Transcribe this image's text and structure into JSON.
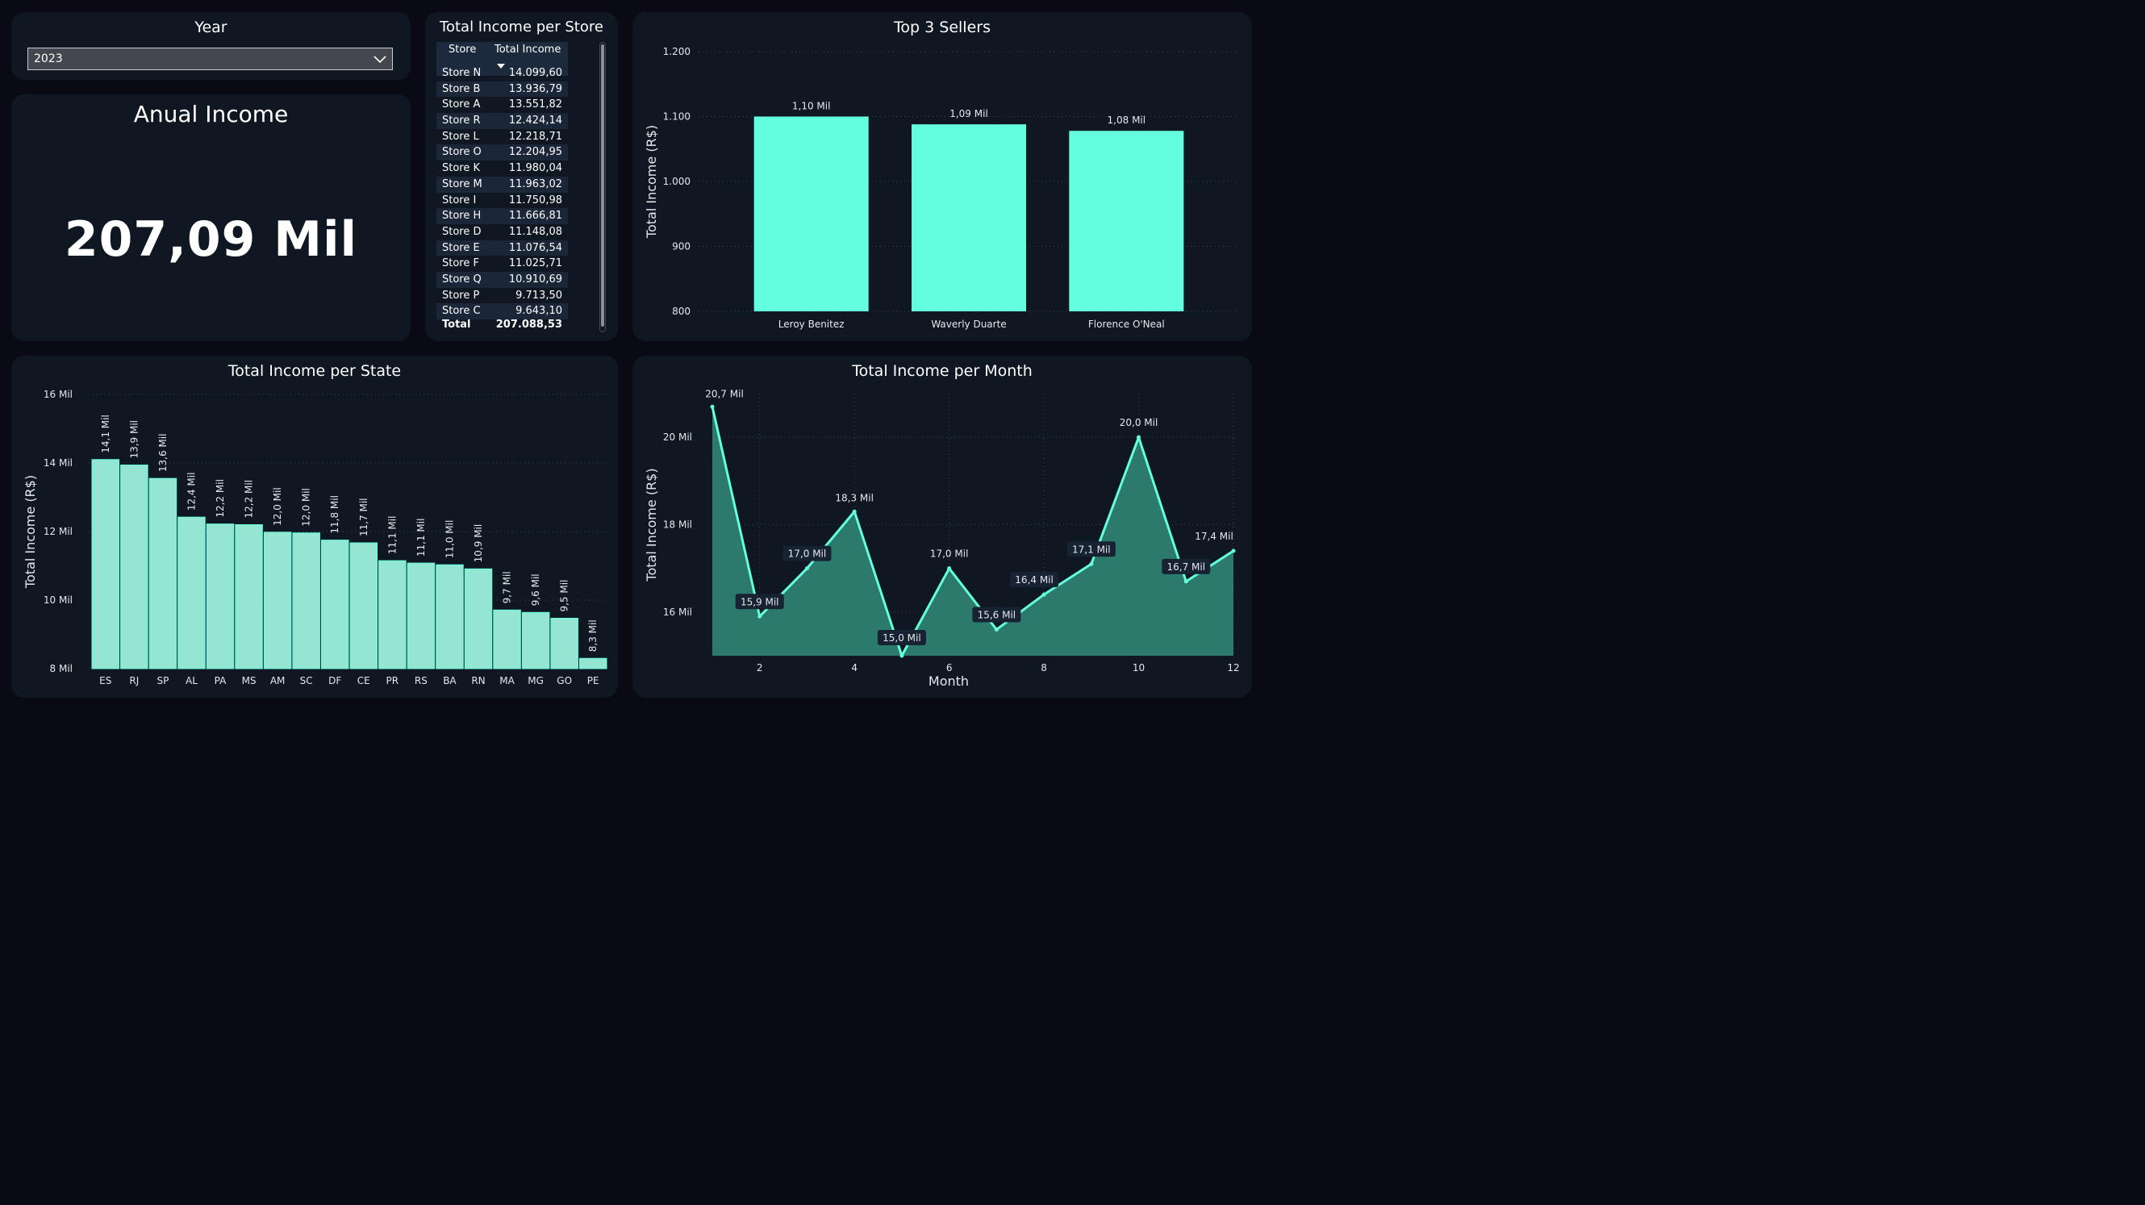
{
  "colors": {
    "background": "#090a14",
    "card": "#0e1722",
    "accent": "#64ffdf",
    "bar_state": "#94e6d3",
    "area_fill": "#2b7a6c",
    "line": "#64ffdf"
  },
  "year_filter": {
    "title": "Year",
    "selected": "2023",
    "icon": "chevron-down-icon"
  },
  "kpi": {
    "title": "Anual Income",
    "value": "207,09 Mil"
  },
  "store_table": {
    "title": "Total Income per Store",
    "headers": [
      "Store",
      "Total Income"
    ],
    "sort_indicator": "sort-descending-icon",
    "rows": [
      [
        "Store N",
        "14.099,60"
      ],
      [
        "Store B",
        "13.936,79"
      ],
      [
        "Store A",
        "13.551,82"
      ],
      [
        "Store R",
        "12.424,14"
      ],
      [
        "Store L",
        "12.218,71"
      ],
      [
        "Store O",
        "12.204,95"
      ],
      [
        "Store K",
        "11.980,04"
      ],
      [
        "Store M",
        "11.963,02"
      ],
      [
        "Store I",
        "11.750,98"
      ],
      [
        "Store H",
        "11.666,81"
      ],
      [
        "Store D",
        "11.148,08"
      ],
      [
        "Store E",
        "11.076,54"
      ],
      [
        "Store F",
        "11.025,71"
      ],
      [
        "Store Q",
        "10.910,69"
      ],
      [
        "Store P",
        "9.713,50"
      ],
      [
        "Store C",
        "9.643,10"
      ]
    ],
    "total": [
      "Total",
      "207.088,53"
    ]
  },
  "chart_data": [
    {
      "type": "bar",
      "title": "Top 3 Sellers",
      "xlabel": "",
      "ylabel": "Total Income (R$)",
      "categories": [
        "Leroy Benitez",
        "Waverly Duarte",
        "Florence O'Neal"
      ],
      "values": [
        1100,
        1088,
        1078
      ],
      "data_labels": [
        "1,10 Mil",
        "1,09 Mil",
        "1,08 Mil"
      ],
      "ylim": [
        800,
        1200
      ],
      "yticks": [
        800,
        900,
        1000,
        1100,
        1200
      ],
      "ytick_labels": [
        "800",
        "900",
        "1.000",
        "1.100",
        "1.200"
      ],
      "grid": true
    },
    {
      "type": "bar",
      "title": "Total Income per State",
      "xlabel": "",
      "ylabel": "Total Income (R$)",
      "categories": [
        "ES",
        "RJ",
        "SP",
        "AL",
        "PA",
        "MS",
        "AM",
        "SC",
        "DF",
        "CE",
        "PR",
        "RS",
        "BA",
        "RN",
        "MA",
        "MG",
        "GO",
        "PE"
      ],
      "values": [
        14.1,
        13.94,
        13.55,
        12.42,
        12.22,
        12.2,
        11.98,
        11.96,
        11.75,
        11.67,
        11.15,
        11.08,
        11.03,
        10.91,
        9.71,
        9.64,
        9.47,
        8.3
      ],
      "data_labels": [
        "14,1 Mil",
        "13,9 Mil",
        "13,6 Mil",
        "12,4 Mil",
        "12,2 Mil",
        "12,2 Mil",
        "12,0 Mil",
        "12,0 Mil",
        "11,8 Mil",
        "11,7 Mil",
        "11,1 Mil",
        "11,1 Mil",
        "11,0 Mil",
        "10,9 Mil",
        "9,7 Mil",
        "9,6 Mil",
        "9,5 Mil",
        "8,3 Mil"
      ],
      "ylim": [
        8,
        16
      ],
      "yticks": [
        8,
        10,
        12,
        14,
        16
      ],
      "ytick_labels": [
        "8 Mil",
        "10 Mil",
        "12 Mil",
        "14 Mil",
        "16 Mil"
      ],
      "grid": true
    },
    {
      "type": "area",
      "title": "Total Income per Month",
      "xlabel": "Month",
      "ylabel": "Total Income (R$)",
      "x": [
        1,
        2,
        3,
        4,
        5,
        6,
        7,
        8,
        9,
        10,
        11,
        12
      ],
      "values": [
        20.7,
        15.9,
        17.0,
        18.3,
        15.0,
        17.0,
        15.6,
        16.4,
        17.1,
        20.0,
        16.7,
        17.4
      ],
      "data_labels": [
        "20,7 Mil",
        "15,9 Mil",
        "17,0 Mil",
        "18,3 Mil",
        "15,0 Mil",
        "17,0 Mil",
        "15,6 Mil",
        "16,4 Mil",
        "17,1 Mil",
        "20,0 Mil",
        "16,7 Mil",
        "17,4 Mil"
      ],
      "xlim": [
        1,
        12
      ],
      "xticks": [
        2,
        4,
        6,
        8,
        10,
        12
      ],
      "xtick_labels": [
        "2",
        "4",
        "6",
        "8",
        "10",
        "12"
      ],
      "ylim": [
        15,
        21
      ],
      "yticks": [
        16,
        18,
        20
      ],
      "ytick_labels": [
        "16 Mil",
        "18 Mil",
        "20 Mil"
      ],
      "grid": true
    }
  ]
}
